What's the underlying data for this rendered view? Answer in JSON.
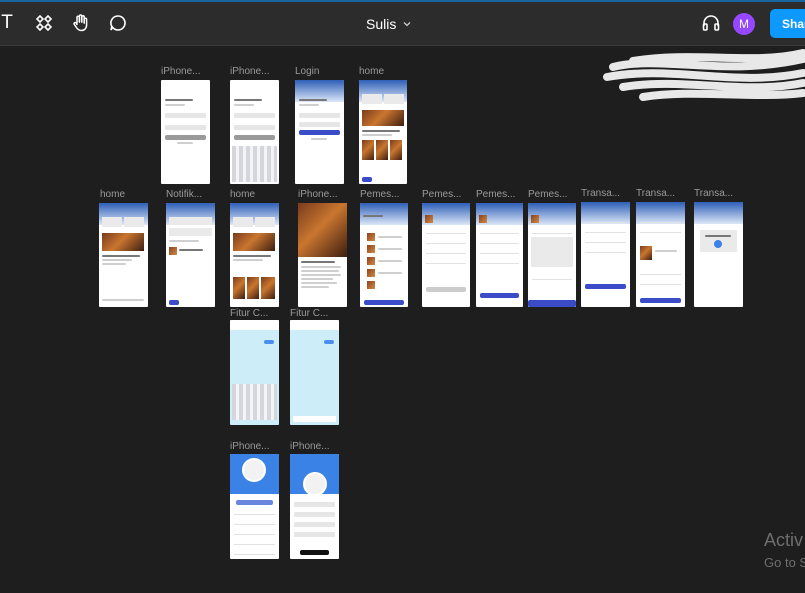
{
  "toolbar": {
    "text_tool_glyph": "T",
    "file_title": "Sulis",
    "avatar_initial": "M",
    "share_label": "Share",
    "accent_color": "#0d99ff",
    "avatar_color": "#9747ff",
    "icons": [
      "text-tool-icon",
      "components-icon",
      "hand-tool-icon",
      "comment-icon",
      "chevron-down-icon",
      "headphones-icon"
    ]
  },
  "frames": [
    {
      "label": "iPhone..."
    },
    {
      "label": "iPhone..."
    },
    {
      "label": "Login"
    },
    {
      "label": "home"
    },
    {
      "label": "home"
    },
    {
      "label": "Notifik..."
    },
    {
      "label": "home"
    },
    {
      "label": "iPhone..."
    },
    {
      "label": "Pemes..."
    },
    {
      "label": "Pemes..."
    },
    {
      "label": "Pemes..."
    },
    {
      "label": "Pemes..."
    },
    {
      "label": "Transa..."
    },
    {
      "label": "Transa..."
    },
    {
      "label": "Transa..."
    },
    {
      "label": "Fitur C..."
    },
    {
      "label": "Fitur C..."
    },
    {
      "label": "iPhone..."
    },
    {
      "label": "iPhone..."
    }
  ],
  "watermark": {
    "line1": "Activ",
    "line2": "Go to S"
  }
}
